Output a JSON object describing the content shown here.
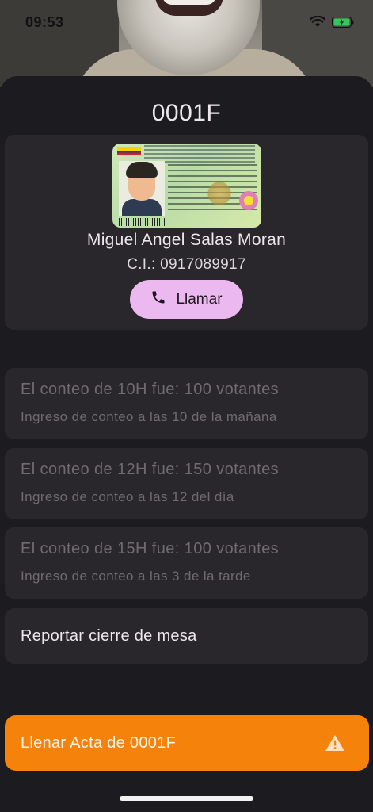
{
  "status_bar": {
    "time": "09:53"
  },
  "header": {
    "title": "0001F"
  },
  "person": {
    "name": "Miguel Angel Salas Moran",
    "ci": "C.I.: 0917089917",
    "call_label": "Llamar"
  },
  "counts": [
    {
      "title": "El conteo de 10H fue: 100 votantes",
      "subtitle": "Ingreso de conteo a las 10 de la mañana"
    },
    {
      "title": "El conteo de 12H fue: 150 votantes",
      "subtitle": "Ingreso de conteo a las 12 del día"
    },
    {
      "title": "El conteo de 15H fue: 100 votantes",
      "subtitle": "Ingreso de conteo a las 3 de la tarde"
    }
  ],
  "report": {
    "label": "Reportar cierre de mesa"
  },
  "action": {
    "label": "Llenar Acta de 0001F"
  },
  "icons": [
    "wifi-icon",
    "battery-icon",
    "phone-icon",
    "warning-icon"
  ],
  "colors": {
    "accent": "#f5820b",
    "call_button": "#ebb8ef",
    "card": "#29272b",
    "background": "#1c1b1f"
  }
}
